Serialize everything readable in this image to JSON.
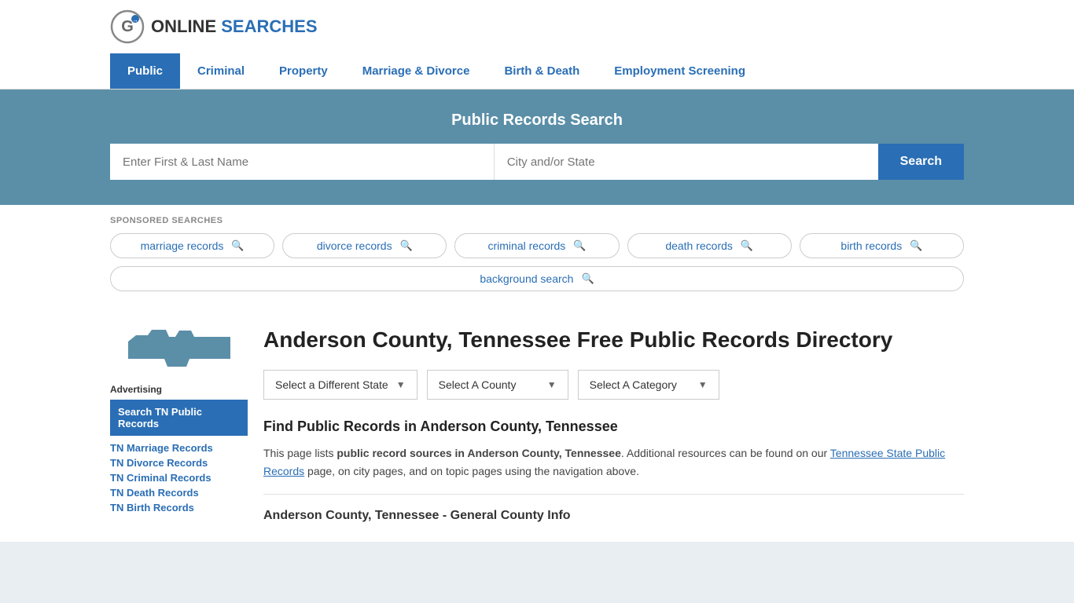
{
  "logo": {
    "text_online": "ONLINE",
    "text_searches": "SEARCHES"
  },
  "nav": {
    "items": [
      {
        "label": "Public",
        "active": true
      },
      {
        "label": "Criminal",
        "active": false
      },
      {
        "label": "Property",
        "active": false
      },
      {
        "label": "Marriage & Divorce",
        "active": false
      },
      {
        "label": "Birth & Death",
        "active": false
      },
      {
        "label": "Employment Screening",
        "active": false
      }
    ]
  },
  "search_banner": {
    "title": "Public Records Search",
    "name_placeholder": "Enter First & Last Name",
    "location_placeholder": "City and/or State",
    "search_button": "Search"
  },
  "sponsored": {
    "label": "SPONSORED SEARCHES",
    "tags": [
      "marriage records",
      "divorce records",
      "criminal records",
      "death records",
      "birth records",
      "background search"
    ]
  },
  "page": {
    "title": "Anderson County, Tennessee Free Public Records Directory",
    "state_label": "Tennessee",
    "dropdowns": {
      "state": "Select a Different State",
      "county": "Select A County",
      "category": "Select A Category"
    },
    "find_title": "Find Public Records in Anderson County, Tennessee",
    "find_text_1": "This page lists ",
    "find_text_bold": "public record sources in Anderson County, Tennessee",
    "find_text_2": ". Additional resources can be found on our ",
    "find_link": "Tennessee State Public Records",
    "find_text_3": " page, on city pages, and on topic pages using the navigation above.",
    "section_title": "Anderson County, Tennessee - General County Info"
  },
  "sidebar": {
    "ad_label": "Advertising",
    "ad_block_text": "Search TN Public Records",
    "links": [
      "TN Marriage Records",
      "TN Divorce Records",
      "TN Criminal Records",
      "TN Death Records",
      "TN Birth Records"
    ]
  }
}
